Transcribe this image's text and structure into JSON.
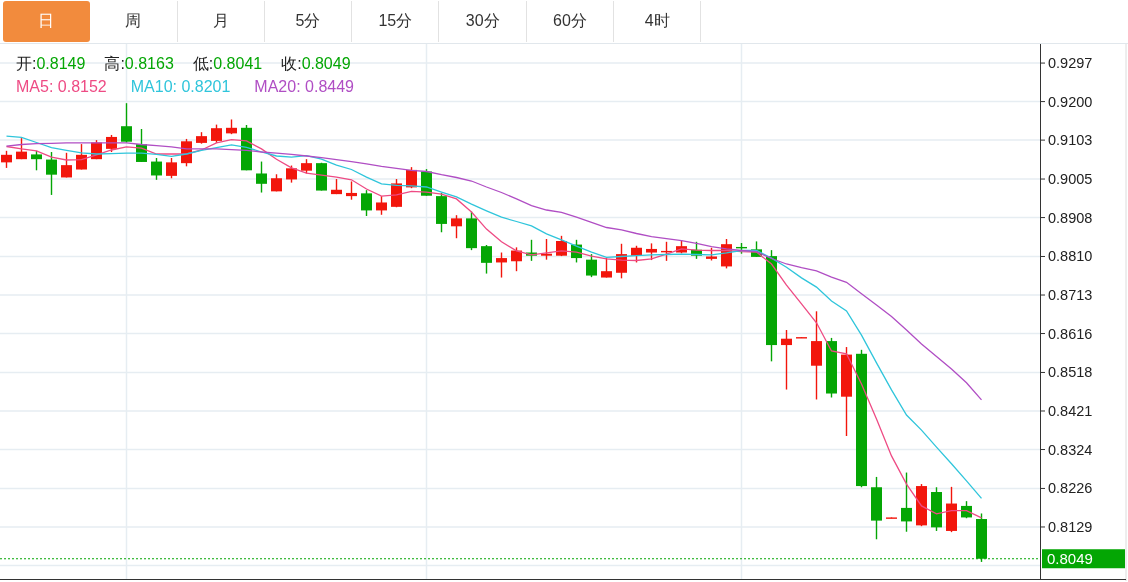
{
  "tabs": [
    {
      "label": "日",
      "selected": true
    },
    {
      "label": "周",
      "selected": false
    },
    {
      "label": "月",
      "selected": false
    },
    {
      "label": "5分",
      "selected": false
    },
    {
      "label": "15分",
      "selected": false
    },
    {
      "label": "30分",
      "selected": false
    },
    {
      "label": "60分",
      "selected": false
    },
    {
      "label": "4时",
      "selected": false
    }
  ],
  "chart": {
    "ohlc": [
      {
        "label": "开:",
        "value": "0.8149"
      },
      {
        "label": "高:",
        "value": "0.8163"
      },
      {
        "label": "低:",
        "value": "0.8041"
      },
      {
        "label": "收:",
        "value": "0.8049"
      }
    ],
    "chart_data": {
      "type": "candlestick",
      "grid": true,
      "ylim": [
        0.7998,
        0.9345
      ],
      "yticks": [
        {
          "value": 0.9297,
          "label": "0.9297"
        },
        {
          "value": 0.92,
          "label": "0.9200"
        },
        {
          "value": 0.9103,
          "label": "0.9103"
        },
        {
          "value": 0.9005,
          "label": "0.9005"
        },
        {
          "value": 0.8908,
          "label": "0.8908"
        },
        {
          "value": 0.881,
          "label": "0.8810"
        },
        {
          "value": 0.8713,
          "label": "0.8713"
        },
        {
          "value": 0.8616,
          "label": "0.8616"
        },
        {
          "value": 0.8518,
          "label": "0.8518"
        },
        {
          "value": 0.8421,
          "label": "0.8421"
        },
        {
          "value": 0.8324,
          "label": "0.8324"
        },
        {
          "value": 0.8226,
          "label": "0.8226"
        },
        {
          "value": 0.8129,
          "label": "0.8129"
        }
      ],
      "ref_lines": [
        {
          "axis": "y",
          "value": 0.8049,
          "label": "0.8049",
          "color": "#04a604"
        }
      ],
      "ohlc": [
        [
          0.9047,
          0.9076,
          0.9033,
          0.9066
        ],
        [
          0.9055,
          0.9108,
          0.9055,
          0.9074
        ],
        [
          0.9067,
          0.9076,
          0.9027,
          0.9055
        ],
        [
          0.9054,
          0.9073,
          0.8965,
          0.9016
        ],
        [
          0.9009,
          0.9071,
          0.9009,
          0.904
        ],
        [
          0.9029,
          0.9093,
          0.9029,
          0.9066
        ],
        [
          0.9055,
          0.9103,
          0.9055,
          0.9097
        ],
        [
          0.9081,
          0.9116,
          0.9073,
          0.9111
        ],
        [
          0.9138,
          0.9196,
          0.9097,
          0.9099
        ],
        [
          0.9093,
          0.9131,
          0.9048,
          0.9048
        ],
        [
          0.9049,
          0.9058,
          0.9003,
          0.9014
        ],
        [
          0.9013,
          0.9058,
          0.9007,
          0.9047
        ],
        [
          0.9045,
          0.9106,
          0.9037,
          0.91
        ],
        [
          0.9096,
          0.9123,
          0.9094,
          0.9113
        ],
        [
          0.9101,
          0.9142,
          0.9096,
          0.9133
        ],
        [
          0.912,
          0.9155,
          0.9118,
          0.9134
        ],
        [
          0.9134,
          0.9141,
          0.9027,
          0.9027
        ],
        [
          0.9019,
          0.9049,
          0.8971,
          0.8993
        ],
        [
          0.8974,
          0.9017,
          0.8974,
          0.9007
        ],
        [
          0.9004,
          0.9039,
          0.8996,
          0.9032
        ],
        [
          0.9026,
          0.9055,
          0.9019,
          0.9045
        ],
        [
          0.9045,
          0.9046,
          0.8976,
          0.8976
        ],
        [
          0.8967,
          0.9005,
          0.8967,
          0.8978
        ],
        [
          0.8962,
          0.8999,
          0.8953,
          0.897
        ],
        [
          0.8969,
          0.8977,
          0.8912,
          0.8926
        ],
        [
          0.8926,
          0.8962,
          0.8915,
          0.8946
        ],
        [
          0.8935,
          0.9005,
          0.8934,
          0.8994
        ],
        [
          0.8984,
          0.9035,
          0.8982,
          0.9028
        ],
        [
          0.9024,
          0.903,
          0.8963,
          0.8963
        ],
        [
          0.8962,
          0.897,
          0.8871,
          0.8892
        ],
        [
          0.8886,
          0.8914,
          0.8856,
          0.8906
        ],
        [
          0.8906,
          0.8923,
          0.8826,
          0.8831
        ],
        [
          0.8836,
          0.8839,
          0.8767,
          0.8794
        ],
        [
          0.8795,
          0.882,
          0.8757,
          0.8806
        ],
        [
          0.8798,
          0.8833,
          0.8773,
          0.8825
        ],
        [
          0.882,
          0.8852,
          0.8799,
          0.8812
        ],
        [
          0.8812,
          0.8854,
          0.8802,
          0.8817
        ],
        [
          0.8812,
          0.8862,
          0.8811,
          0.8849
        ],
        [
          0.884,
          0.8852,
          0.8795,
          0.8806
        ],
        [
          0.8802,
          0.8816,
          0.8758,
          0.8762
        ],
        [
          0.8757,
          0.8806,
          0.8757,
          0.8773
        ],
        [
          0.8769,
          0.8842,
          0.8755,
          0.8816
        ],
        [
          0.8812,
          0.8837,
          0.8795,
          0.8832
        ],
        [
          0.882,
          0.8843,
          0.8801,
          0.8829
        ],
        [
          0.8822,
          0.8847,
          0.8799,
          0.8824
        ],
        [
          0.882,
          0.8851,
          0.8818,
          0.8836
        ],
        [
          0.8827,
          0.8847,
          0.8804,
          0.8812
        ],
        [
          0.8804,
          0.8832,
          0.88,
          0.881
        ],
        [
          0.8785,
          0.8854,
          0.878,
          0.8841
        ],
        [
          0.8834,
          0.8844,
          0.8817,
          0.8831
        ],
        [
          0.8828,
          0.8848,
          0.8809,
          0.8809
        ],
        [
          0.8811,
          0.8826,
          0.8546,
          0.8587
        ],
        [
          0.8587,
          0.8625,
          0.8475,
          0.8603
        ],
        [
          0.8605,
          0.8607,
          0.8605,
          0.8607
        ],
        [
          0.8535,
          0.8672,
          0.845,
          0.8597
        ],
        [
          0.8597,
          0.8605,
          0.8455,
          0.8465
        ],
        [
          0.8457,
          0.8582,
          0.8358,
          0.8563
        ],
        [
          0.8565,
          0.8575,
          0.8229,
          0.8232
        ],
        [
          0.8229,
          0.8255,
          0.8098,
          0.8145
        ],
        [
          0.8151,
          0.8153,
          0.8151,
          0.8153
        ],
        [
          0.8177,
          0.8266,
          0.8117,
          0.8143
        ],
        [
          0.8133,
          0.8237,
          0.8131,
          0.8232
        ],
        [
          0.8217,
          0.8229,
          0.8119,
          0.8128
        ],
        [
          0.8119,
          0.823,
          0.8116,
          0.8188
        ],
        [
          0.8182,
          0.8194,
          0.8151,
          0.8153
        ],
        [
          0.8149,
          0.8163,
          0.8041,
          0.8049
        ]
      ],
      "series": [
        {
          "type": "line",
          "name": "MA5: 0.8152",
          "color": "#ee4b84",
          "values": [
            0.9087,
            0.9081,
            0.9076,
            0.906,
            0.9053,
            0.9054,
            0.9066,
            0.9078,
            0.9086,
            0.9083,
            0.9068,
            0.9068,
            0.9068,
            0.9078,
            0.9096,
            0.9104,
            0.9101,
            0.9081,
            0.9055,
            0.9033,
            0.902,
            0.9015,
            0.901,
            0.9003,
            0.898,
            0.8962,
            0.8965,
            0.8974,
            0.8972,
            0.8967,
            0.8955,
            0.8922,
            0.8879,
            0.8847,
            0.8824,
            0.8814,
            0.8819,
            0.8824,
            0.8821,
            0.8811,
            0.8804,
            0.8801,
            0.88,
            0.8804,
            0.8816,
            0.8829,
            0.8826,
            0.8825,
            0.8825,
            0.8822,
            0.8821,
            0.8791,
            0.8738,
            0.8691,
            0.8643,
            0.8572,
            0.8565,
            0.8489,
            0.8401,
            0.8308,
            0.8237,
            0.8182,
            0.8162,
            0.817,
            0.817,
            0.8152
          ]
        },
        {
          "type": "line",
          "name": "MA10: 0.8201",
          "color": "#2fc5db",
          "values": [
            0.9113,
            0.911,
            0.9097,
            0.9084,
            0.9077,
            0.9071,
            0.9068,
            0.9069,
            0.907,
            0.907,
            0.9067,
            0.9062,
            0.9068,
            0.9077,
            0.9084,
            0.9091,
            0.9085,
            0.9073,
            0.9063,
            0.906,
            0.9064,
            0.9055,
            0.904,
            0.9029,
            0.901,
            0.8993,
            0.8989,
            0.8988,
            0.8985,
            0.8972,
            0.896,
            0.8942,
            0.8925,
            0.8909,
            0.8898,
            0.8887,
            0.8867,
            0.8852,
            0.8836,
            0.8821,
            0.8808,
            0.881,
            0.8812,
            0.8814,
            0.8815,
            0.8816,
            0.8815,
            0.8814,
            0.8819,
            0.8825,
            0.8825,
            0.8806,
            0.8783,
            0.8756,
            0.8733,
            0.8698,
            0.8673,
            0.8612,
            0.8542,
            0.8474,
            0.8411,
            0.8373,
            0.833,
            0.8288,
            0.8245,
            0.8201
          ]
        },
        {
          "type": "line",
          "name": "MA20: 0.8449",
          "color": "#b04ec4",
          "values": [
            0.9088,
            0.9092,
            0.9094,
            0.9095,
            0.9096,
            0.9096,
            0.9096,
            0.9096,
            0.9096,
            0.9092,
            0.9089,
            0.9086,
            0.9081,
            0.9081,
            0.9081,
            0.9079,
            0.9077,
            0.9073,
            0.907,
            0.9067,
            0.9063,
            0.9059,
            0.9054,
            0.9049,
            0.9043,
            0.9037,
            0.9032,
            0.9027,
            0.9024,
            0.9016,
            0.9009,
            0.9,
            0.8985,
            0.8971,
            0.8955,
            0.8938,
            0.8927,
            0.8921,
            0.8909,
            0.8896,
            0.8883,
            0.8877,
            0.8868,
            0.886,
            0.8855,
            0.885,
            0.8843,
            0.8835,
            0.8829,
            0.8825,
            0.8822,
            0.8805,
            0.8791,
            0.8782,
            0.8774,
            0.8758,
            0.8745,
            0.8716,
            0.8688,
            0.8659,
            0.8625,
            0.859,
            0.8558,
            0.8527,
            0.8492,
            0.8449
          ]
        }
      ]
    }
  }
}
